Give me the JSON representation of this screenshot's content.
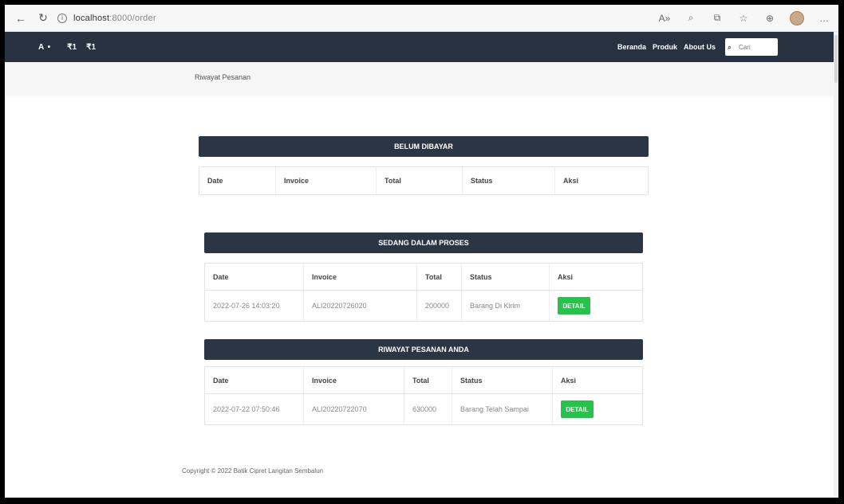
{
  "browser": {
    "url_host": "localhost",
    "url_path": ":8000/order",
    "icons": [
      "back-icon",
      "refresh-icon",
      "info-icon",
      "read-aloud-icon",
      "zoom-icon",
      "extensions-icon",
      "favorites-icon",
      "collections-icon",
      "profile-icon",
      "more-icon"
    ]
  },
  "navbar": {
    "brand": "A •",
    "icon1": "₹1",
    "icon2": "₹1",
    "links": [
      "Beranda",
      "Produk",
      "About Us"
    ],
    "search_placeholder": "Cari"
  },
  "breadcrumb": "Riwayat Pesanan",
  "sections": [
    {
      "title": "BELUM DIBAYAR",
      "headers": [
        "Date",
        "Invoice",
        "Total",
        "Status",
        "Aksi"
      ],
      "rows": []
    },
    {
      "title": "SEDANG DALAM PROSES",
      "headers": [
        "Date",
        "Invoice",
        "Total",
        "Status",
        "Aksi"
      ],
      "rows": [
        {
          "date": "2022-07-26 14:03:20",
          "invoice": "ALI20220726020",
          "total": "200000",
          "status": "Barang Di Kirim",
          "action": "DETAIL"
        }
      ]
    },
    {
      "title": "RIWAYAT PESANAN ANDA",
      "headers": [
        "Date",
        "Invoice",
        "Total",
        "Status",
        "Aksi"
      ],
      "rows": [
        {
          "date": "2022-07-22 07:50:46",
          "invoice": "ALI20220722070",
          "total": "630000",
          "status": "Barang Telah Sampai",
          "action": "DETAIL"
        }
      ]
    }
  ],
  "footer": "Copyright © 2022 Batik Cipret Langitan Sembalun",
  "colors": {
    "navbar": "#27313f",
    "section_header": "#2b3644",
    "detail_button": "#27c24c"
  }
}
